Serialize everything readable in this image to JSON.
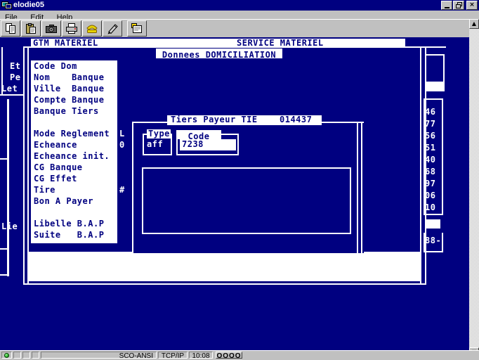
{
  "window": {
    "title": "elodie05",
    "menu": [
      {
        "label": "File"
      },
      {
        "label": "Edit"
      },
      {
        "label": "Help"
      }
    ]
  },
  "toolbar": {
    "icons": [
      "copy",
      "paste",
      "camera",
      "printer",
      "phone",
      "pen",
      "session-setup"
    ]
  },
  "screen": {
    "header_left": "GTM MATERIEL",
    "header_right": "SERVICE MATERIEL",
    "left_labels": {
      "l1": "Et",
      "l2": "Pe",
      "l3": "Let",
      "l4": "Lie"
    },
    "domiciliation": {
      "title": "Donnees DOMICILIATION",
      "fields": [
        "Code Dom",
        "Nom    Banque",
        "Ville  Banque",
        "Compte Banque",
        "Banque Tiers",
        "",
        "Mode Reglement",
        "Echeance",
        "Echeance init.",
        "CG Banque",
        "CG Effet",
        "Tire",
        "Bon A Payer",
        "",
        "Libelle B.A.P",
        "Suite   B.A.P"
      ],
      "side_values": {
        "mode_reglement": "L",
        "echeance": "0",
        "tire": "#"
      }
    },
    "right_column": {
      "numbers": [
        "46",
        "77",
        "56",
        "51",
        "40",
        "68",
        "97",
        "06",
        "10"
      ],
      "extra": "88-"
    },
    "tiers_payeur": {
      "title": "Tiers Payeur TIE",
      "number": "014437",
      "type_label": "Type",
      "type_value": "aff",
      "code_label": "Code",
      "code_value": "7238"
    }
  },
  "statusbar": {
    "emulation": "SCO-ANSI",
    "protocol": "TCP/IP",
    "time": "10:08",
    "indicator": "OOOO"
  },
  "colors": {
    "terminal_blue": "#000080",
    "chrome_gray": "#c0c0c0",
    "phone_yellow": "#e6d200"
  }
}
